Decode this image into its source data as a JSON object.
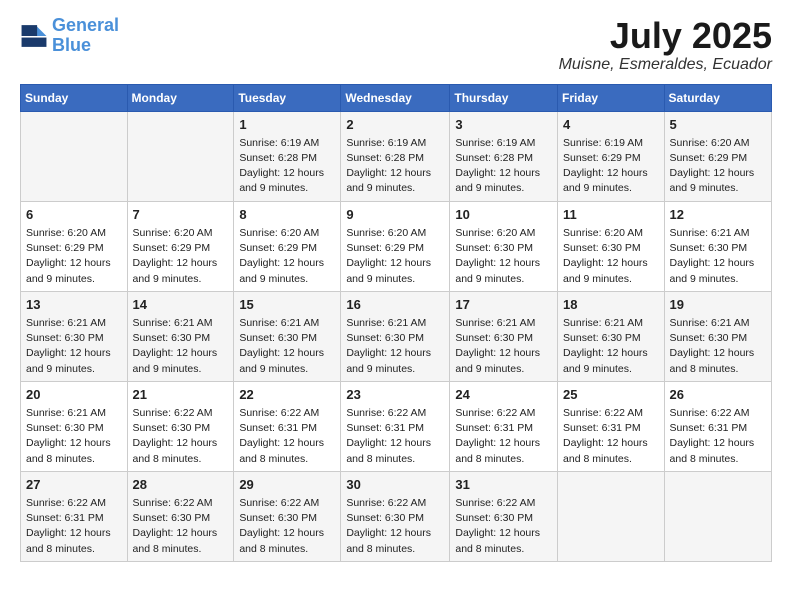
{
  "logo": {
    "line1": "General",
    "line2": "Blue"
  },
  "title": "July 2025",
  "location": "Muisne, Esmeraldes, Ecuador",
  "weekdays": [
    "Sunday",
    "Monday",
    "Tuesday",
    "Wednesday",
    "Thursday",
    "Friday",
    "Saturday"
  ],
  "weeks": [
    [
      {
        "day": "",
        "info": ""
      },
      {
        "day": "",
        "info": ""
      },
      {
        "day": "1",
        "info": "Sunrise: 6:19 AM\nSunset: 6:28 PM\nDaylight: 12 hours\nand 9 minutes."
      },
      {
        "day": "2",
        "info": "Sunrise: 6:19 AM\nSunset: 6:28 PM\nDaylight: 12 hours\nand 9 minutes."
      },
      {
        "day": "3",
        "info": "Sunrise: 6:19 AM\nSunset: 6:28 PM\nDaylight: 12 hours\nand 9 minutes."
      },
      {
        "day": "4",
        "info": "Sunrise: 6:19 AM\nSunset: 6:29 PM\nDaylight: 12 hours\nand 9 minutes."
      },
      {
        "day": "5",
        "info": "Sunrise: 6:20 AM\nSunset: 6:29 PM\nDaylight: 12 hours\nand 9 minutes."
      }
    ],
    [
      {
        "day": "6",
        "info": "Sunrise: 6:20 AM\nSunset: 6:29 PM\nDaylight: 12 hours\nand 9 minutes."
      },
      {
        "day": "7",
        "info": "Sunrise: 6:20 AM\nSunset: 6:29 PM\nDaylight: 12 hours\nand 9 minutes."
      },
      {
        "day": "8",
        "info": "Sunrise: 6:20 AM\nSunset: 6:29 PM\nDaylight: 12 hours\nand 9 minutes."
      },
      {
        "day": "9",
        "info": "Sunrise: 6:20 AM\nSunset: 6:29 PM\nDaylight: 12 hours\nand 9 minutes."
      },
      {
        "day": "10",
        "info": "Sunrise: 6:20 AM\nSunset: 6:30 PM\nDaylight: 12 hours\nand 9 minutes."
      },
      {
        "day": "11",
        "info": "Sunrise: 6:20 AM\nSunset: 6:30 PM\nDaylight: 12 hours\nand 9 minutes."
      },
      {
        "day": "12",
        "info": "Sunrise: 6:21 AM\nSunset: 6:30 PM\nDaylight: 12 hours\nand 9 minutes."
      }
    ],
    [
      {
        "day": "13",
        "info": "Sunrise: 6:21 AM\nSunset: 6:30 PM\nDaylight: 12 hours\nand 9 minutes."
      },
      {
        "day": "14",
        "info": "Sunrise: 6:21 AM\nSunset: 6:30 PM\nDaylight: 12 hours\nand 9 minutes."
      },
      {
        "day": "15",
        "info": "Sunrise: 6:21 AM\nSunset: 6:30 PM\nDaylight: 12 hours\nand 9 minutes."
      },
      {
        "day": "16",
        "info": "Sunrise: 6:21 AM\nSunset: 6:30 PM\nDaylight: 12 hours\nand 9 minutes."
      },
      {
        "day": "17",
        "info": "Sunrise: 6:21 AM\nSunset: 6:30 PM\nDaylight: 12 hours\nand 9 minutes."
      },
      {
        "day": "18",
        "info": "Sunrise: 6:21 AM\nSunset: 6:30 PM\nDaylight: 12 hours\nand 9 minutes."
      },
      {
        "day": "19",
        "info": "Sunrise: 6:21 AM\nSunset: 6:30 PM\nDaylight: 12 hours\nand 8 minutes."
      }
    ],
    [
      {
        "day": "20",
        "info": "Sunrise: 6:21 AM\nSunset: 6:30 PM\nDaylight: 12 hours\nand 8 minutes."
      },
      {
        "day": "21",
        "info": "Sunrise: 6:22 AM\nSunset: 6:30 PM\nDaylight: 12 hours\nand 8 minutes."
      },
      {
        "day": "22",
        "info": "Sunrise: 6:22 AM\nSunset: 6:31 PM\nDaylight: 12 hours\nand 8 minutes."
      },
      {
        "day": "23",
        "info": "Sunrise: 6:22 AM\nSunset: 6:31 PM\nDaylight: 12 hours\nand 8 minutes."
      },
      {
        "day": "24",
        "info": "Sunrise: 6:22 AM\nSunset: 6:31 PM\nDaylight: 12 hours\nand 8 minutes."
      },
      {
        "day": "25",
        "info": "Sunrise: 6:22 AM\nSunset: 6:31 PM\nDaylight: 12 hours\nand 8 minutes."
      },
      {
        "day": "26",
        "info": "Sunrise: 6:22 AM\nSunset: 6:31 PM\nDaylight: 12 hours\nand 8 minutes."
      }
    ],
    [
      {
        "day": "27",
        "info": "Sunrise: 6:22 AM\nSunset: 6:31 PM\nDaylight: 12 hours\nand 8 minutes."
      },
      {
        "day": "28",
        "info": "Sunrise: 6:22 AM\nSunset: 6:30 PM\nDaylight: 12 hours\nand 8 minutes."
      },
      {
        "day": "29",
        "info": "Sunrise: 6:22 AM\nSunset: 6:30 PM\nDaylight: 12 hours\nand 8 minutes."
      },
      {
        "day": "30",
        "info": "Sunrise: 6:22 AM\nSunset: 6:30 PM\nDaylight: 12 hours\nand 8 minutes."
      },
      {
        "day": "31",
        "info": "Sunrise: 6:22 AM\nSunset: 6:30 PM\nDaylight: 12 hours\nand 8 minutes."
      },
      {
        "day": "",
        "info": ""
      },
      {
        "day": "",
        "info": ""
      }
    ]
  ]
}
